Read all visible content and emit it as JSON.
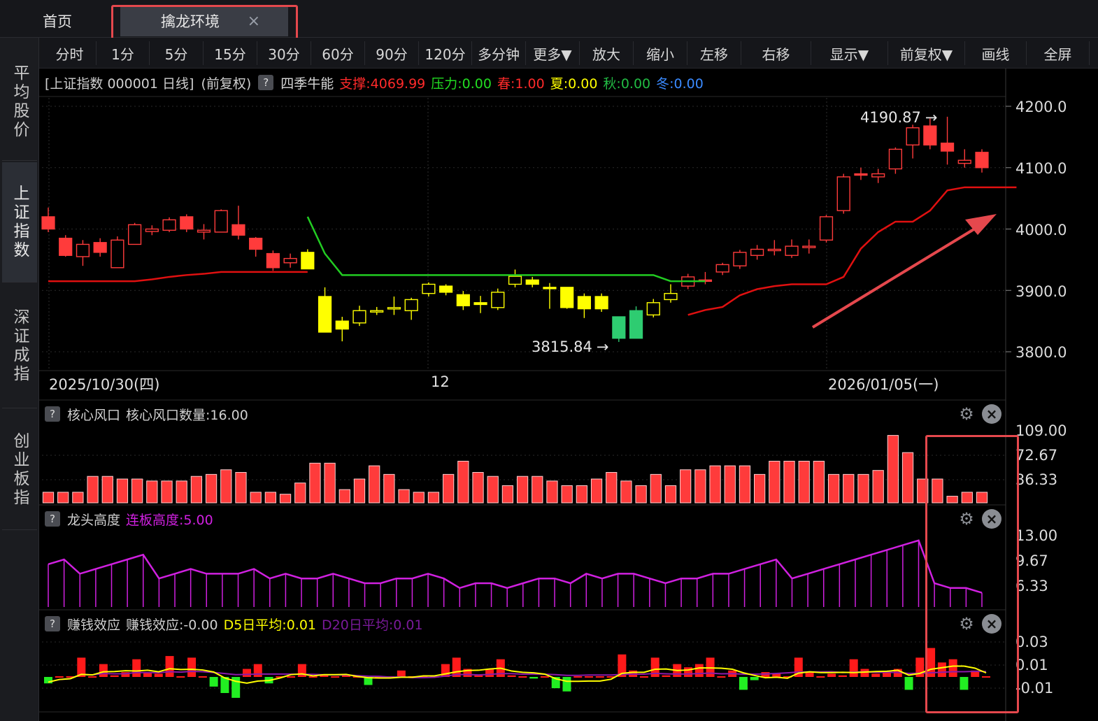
{
  "tabs": {
    "home": "首页",
    "active": "擒龙环境",
    "close_icon": "×"
  },
  "sidebar": [
    "平均股价",
    "上证指数",
    "深证成指",
    "创业板指"
  ],
  "toolbar": [
    "分时",
    "1分",
    "5分",
    "15分",
    "30分",
    "60分",
    "90分",
    "120分",
    "多分钟",
    "更多▼",
    "放大",
    "缩小",
    "左移",
    "右移",
    "显示▼",
    "前复权▼",
    "画线",
    "全屏"
  ],
  "info": {
    "title": "[上证指数 000001 日线]",
    "adj": "(前复权)",
    "indicator": "四季牛能",
    "support": "支撑:4069.99",
    "pressure": "压力:0.00",
    "spring": "春:1.00",
    "summer": "夏:0.00",
    "autumn": "秋:0.00",
    "winter": "冬:0.00",
    "qmark": "?"
  },
  "price_axis": [
    "4200.0",
    "4100.0",
    "4000.0",
    "3900.0",
    "3800.0"
  ],
  "dates": [
    "2025/10/30(四)",
    "12",
    "2026/01/05(一)"
  ],
  "annotations": {
    "high": "4190.87",
    "low": "3815.84"
  },
  "panel1": {
    "name": "核心风口",
    "metric": "核心风口数量:16.00",
    "axis": [
      "109.00",
      "72.67",
      "36.33"
    ]
  },
  "panel2": {
    "name": "龙头高度",
    "metric": "连板高度:5.00",
    "axis": [
      "13.00",
      "9.67",
      "6.33"
    ]
  },
  "panel3": {
    "name": "赚钱效应",
    "metric": "赚钱效应:-0.00",
    "d5": "D5日平均:0.01",
    "d20": "D20日平均:0.01",
    "axis": [
      "0.03",
      "0.01",
      "-0.01"
    ]
  },
  "colors": {
    "up": "#ff3b3b",
    "down_y": "#ffff00",
    "down_g": "#2ecc71",
    "purple": "#d020e0",
    "red_line": "#e01010",
    "green_line": "#22cc22"
  },
  "chart_data": {
    "type": "candlestick",
    "ylim": [
      3780,
      4220
    ],
    "candles": [
      {
        "o": 4020,
        "c": 4000,
        "h": 4035,
        "l": 3995,
        "col": "R"
      },
      {
        "o": 3985,
        "c": 3957,
        "h": 3990,
        "l": 3955,
        "col": "R"
      },
      {
        "o": 3955,
        "c": 3975,
        "h": 3982,
        "l": 3940,
        "col": "R"
      },
      {
        "o": 3978,
        "c": 3962,
        "h": 3985,
        "l": 3955,
        "col": "R"
      },
      {
        "o": 3937,
        "c": 3982,
        "h": 3988,
        "l": 3937,
        "col": "R"
      },
      {
        "o": 3975,
        "c": 4007,
        "h": 4010,
        "l": 3975,
        "col": "R"
      },
      {
        "o": 3996,
        "c": 4000,
        "h": 4006,
        "l": 3990,
        "col": "R"
      },
      {
        "o": 3998,
        "c": 4015,
        "h": 4019,
        "l": 3995,
        "col": "R"
      },
      {
        "o": 4020,
        "c": 4000,
        "h": 4024,
        "l": 3995,
        "col": "R"
      },
      {
        "o": 3995,
        "c": 3998,
        "h": 4008,
        "l": 3983,
        "col": "R"
      },
      {
        "o": 3995,
        "c": 4030,
        "h": 4032,
        "l": 3995,
        "col": "R"
      },
      {
        "o": 4007,
        "c": 3990,
        "h": 4038,
        "l": 3983,
        "col": "R"
      },
      {
        "o": 3985,
        "c": 3967,
        "h": 3987,
        "l": 3955,
        "col": "R"
      },
      {
        "o": 3960,
        "c": 3937,
        "h": 3965,
        "l": 3932,
        "col": "R"
      },
      {
        "o": 3945,
        "c": 3952,
        "h": 3960,
        "l": 3937,
        "col": "R"
      },
      {
        "o": 3962,
        "c": 3935,
        "h": 3967,
        "l": 3935,
        "col": "Y"
      },
      {
        "o": 3890,
        "c": 3832,
        "h": 3905,
        "l": 3832,
        "col": "Y"
      },
      {
        "o": 3850,
        "c": 3837,
        "h": 3857,
        "l": 3817,
        "col": "Y"
      },
      {
        "o": 3847,
        "c": 3867,
        "h": 3875,
        "l": 3842,
        "col": "Y"
      },
      {
        "o": 3865,
        "c": 3867,
        "h": 3873,
        "l": 3860,
        "col": "Y"
      },
      {
        "o": 3870,
        "c": 3872,
        "h": 3890,
        "l": 3860,
        "col": "Y"
      },
      {
        "o": 3867,
        "c": 3885,
        "h": 3888,
        "l": 3852,
        "col": "Y"
      },
      {
        "o": 3895,
        "c": 3910,
        "h": 3913,
        "l": 3890,
        "col": "Y"
      },
      {
        "o": 3907,
        "c": 3897,
        "h": 3910,
        "l": 3892,
        "col": "Y"
      },
      {
        "o": 3893,
        "c": 3875,
        "h": 3899,
        "l": 3868,
        "col": "Y"
      },
      {
        "o": 3880,
        "c": 3877,
        "h": 3891,
        "l": 3863,
        "col": "Y"
      },
      {
        "o": 3872,
        "c": 3897,
        "h": 3903,
        "l": 3868,
        "col": "Y"
      },
      {
        "o": 3910,
        "c": 3923,
        "h": 3934,
        "l": 3905,
        "col": "Y"
      },
      {
        "o": 3917,
        "c": 3910,
        "h": 3922,
        "l": 3905,
        "col": "Y"
      },
      {
        "o": 3905,
        "c": 3905,
        "h": 3912,
        "l": 3870,
        "col": "Y"
      },
      {
        "o": 3905,
        "c": 3872,
        "h": 3905,
        "l": 3870,
        "col": "Y"
      },
      {
        "o": 3890,
        "c": 3870,
        "h": 3895,
        "l": 3855,
        "col": "Y"
      },
      {
        "o": 3890,
        "c": 3870,
        "h": 3895,
        "l": 3865,
        "col": "Y"
      },
      {
        "o": 3857,
        "c": 3822,
        "h": 3857,
        "l": 3816,
        "col": "G"
      },
      {
        "o": 3822,
        "c": 3867,
        "h": 3874,
        "l": 3822,
        "col": "G"
      },
      {
        "o": 3860,
        "c": 3880,
        "h": 3886,
        "l": 3856,
        "col": "Y"
      },
      {
        "o": 3885,
        "c": 3895,
        "h": 3910,
        "l": 3880,
        "col": "Y"
      },
      {
        "o": 3907,
        "c": 3922,
        "h": 3927,
        "l": 3902,
        "col": "R"
      },
      {
        "o": 3917,
        "c": 3917,
        "h": 3930,
        "l": 3910,
        "col": "R"
      },
      {
        "o": 3930,
        "c": 3942,
        "h": 3945,
        "l": 3925,
        "col": "R"
      },
      {
        "o": 3940,
        "c": 3962,
        "h": 3966,
        "l": 3935,
        "col": "R"
      },
      {
        "o": 3957,
        "c": 3967,
        "h": 3974,
        "l": 3950,
        "col": "R"
      },
      {
        "o": 3965,
        "c": 3967,
        "h": 3982,
        "l": 3957,
        "col": "R"
      },
      {
        "o": 3957,
        "c": 3972,
        "h": 3983,
        "l": 3953,
        "col": "R"
      },
      {
        "o": 3970,
        "c": 3972,
        "h": 3983,
        "l": 3960,
        "col": "R"
      },
      {
        "o": 3982,
        "c": 4020,
        "h": 4023,
        "l": 3978,
        "col": "R"
      },
      {
        "o": 4030,
        "c": 4085,
        "h": 4090,
        "l": 4025,
        "col": "R"
      },
      {
        "o": 4090,
        "c": 4090,
        "h": 4100,
        "l": 4080,
        "col": "R"
      },
      {
        "o": 4085,
        "c": 4090,
        "h": 4098,
        "l": 4075,
        "col": "R"
      },
      {
        "o": 4098,
        "c": 4130,
        "h": 4133,
        "l": 4090,
        "col": "R"
      },
      {
        "o": 4137,
        "c": 4165,
        "h": 4170,
        "l": 4115,
        "col": "R"
      },
      {
        "o": 4168,
        "c": 4137,
        "h": 4180,
        "l": 4130,
        "col": "R"
      },
      {
        "o": 4140,
        "c": 4127,
        "h": 4183,
        "l": 4105,
        "col": "R"
      },
      {
        "o": 4107,
        "c": 4112,
        "h": 4130,
        "l": 4100,
        "col": "R"
      },
      {
        "o": 4125,
        "c": 4100,
        "h": 4130,
        "l": 4092,
        "col": "R"
      }
    ],
    "red_line": [
      3915,
      3915,
      3915,
      3915,
      3915,
      3915,
      3918,
      3922,
      3925,
      3927,
      3930,
      3930,
      3930,
      3930,
      3930,
      3930,
      null,
      null,
      null,
      null,
      null,
      null,
      null,
      null,
      null,
      null,
      null,
      null,
      null,
      null,
      null,
      null,
      null,
      null,
      null,
      null,
      null,
      3860,
      3868,
      3873,
      3892,
      3902,
      3907,
      3910,
      3910,
      3910,
      3922,
      3968,
      3995,
      4012,
      4012,
      4030,
      4063,
      4068,
      4068,
      4068,
      4068
    ],
    "red_line_start": 0,
    "green_line": [
      4020,
      3960,
      3925,
      3925,
      3925,
      3925,
      3925,
      3925,
      3925,
      3925,
      3925,
      3925,
      3925,
      3925,
      3925,
      3925,
      3925,
      3925,
      3925,
      3925,
      3925,
      3915,
      3915,
      3915
    ],
    "green_line_start": 15,
    "core_wind": [
      16,
      16,
      16,
      40,
      40,
      36,
      36,
      33,
      33,
      33,
      40,
      43,
      50,
      46,
      16,
      16,
      13,
      30,
      60,
      60,
      20,
      36,
      56,
      43,
      20,
      16,
      16,
      43,
      63,
      46,
      40,
      26,
      40,
      40,
      33,
      26,
      26,
      36,
      46,
      33,
      26,
      43,
      26,
      50,
      50,
      56,
      56,
      56,
      43,
      63,
      63,
      63,
      63,
      43,
      43,
      43,
      49,
      102,
      76,
      36,
      36,
      10,
      16,
      16
    ],
    "dragon_height": [
      9,
      10,
      7,
      8,
      9,
      10,
      11,
      6,
      7,
      8,
      7,
      7,
      7,
      8,
      6,
      7,
      6,
      6,
      7,
      6,
      5,
      5,
      6,
      6,
      7,
      6,
      4,
      5,
      5,
      4,
      5,
      6,
      6,
      5,
      7,
      6,
      7,
      7,
      6,
      5,
      6,
      6,
      7,
      7,
      8,
      9,
      10,
      6,
      7,
      8,
      9,
      10,
      11,
      12,
      13,
      14,
      5,
      4,
      4,
      3
    ],
    "earn_bars": [
      -0.004,
      0.0,
      0.0,
      0.012,
      0.0,
      0.008,
      0.001,
      0.003,
      0.011,
      0.003,
      0.002,
      0.013,
      0.0,
      0.012,
      0.0,
      -0.006,
      -0.01,
      -0.013,
      0.005,
      0.008,
      -0.004,
      0.0,
      0.0,
      0.008,
      0.0,
      0.001,
      0.0,
      0.001,
      0.0,
      -0.005,
      0.0,
      0.0,
      0.004,
      0.0,
      0.0,
      0.0,
      0.008,
      0.012,
      0.005,
      0.001,
      0.005,
      0.011,
      0.001,
      0.0,
      -0.001,
      0.0,
      -0.007,
      -0.009,
      0.0,
      0.0,
      0.0,
      0.0,
      0.014,
      0.004,
      0.0,
      0.012,
      0.001,
      0.008,
      0.006,
      0.008,
      0.012,
      0.0,
      0.004,
      -0.008,
      -0.002,
      0.003,
      0.002,
      0.0,
      0.012,
      0.003,
      0.0,
      0.002,
      0.001,
      0.011,
      0.005,
      0.002,
      0.003,
      0.005,
      -0.008,
      0.012,
      0.018,
      0.009,
      0.011,
      -0.008,
      0.004,
      0.0
    ]
  }
}
